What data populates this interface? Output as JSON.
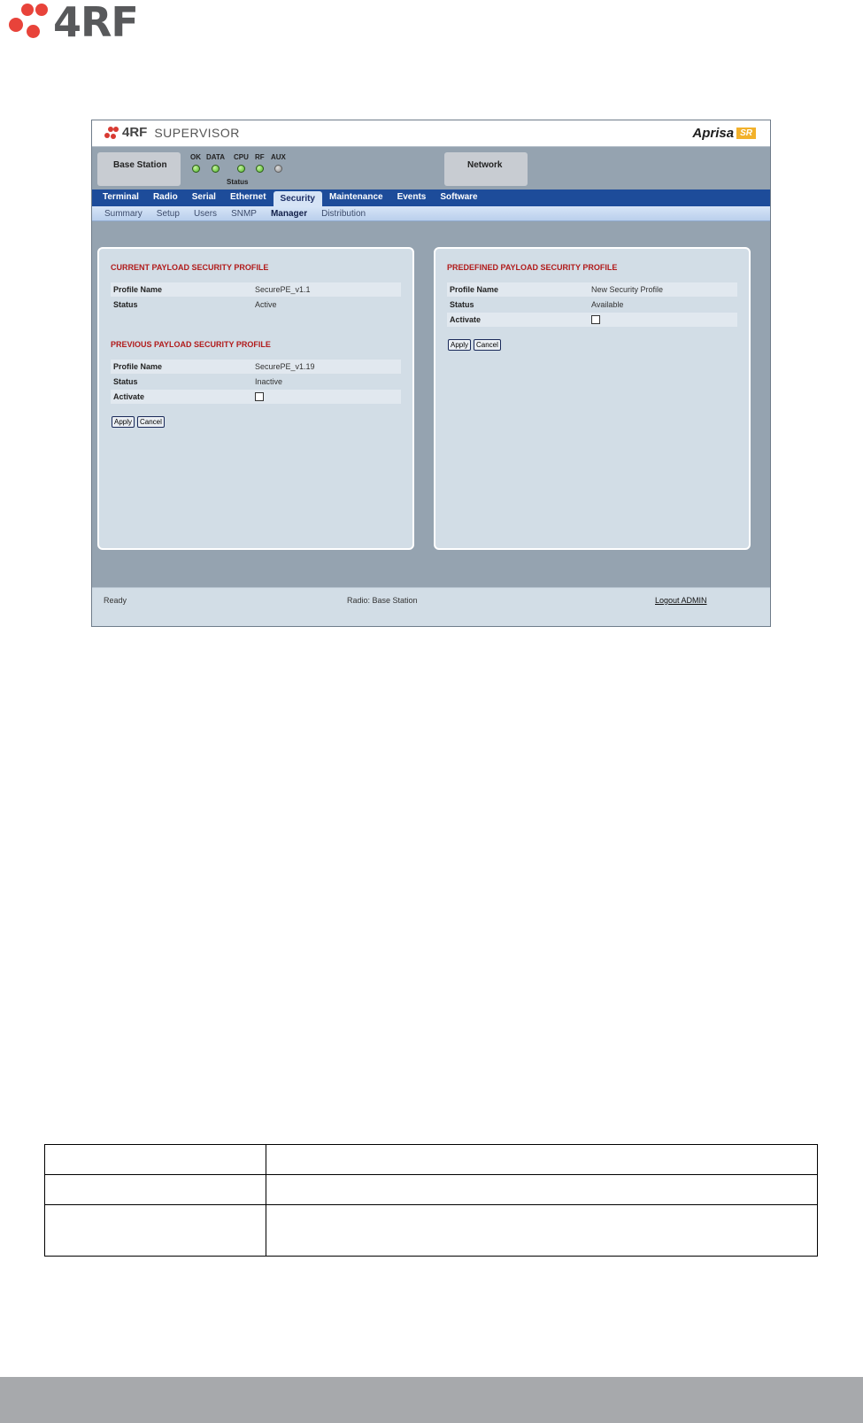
{
  "doc": {
    "brand": "4RF"
  },
  "app": {
    "logo": "4RF",
    "logo_suffix": "SUPERVISOR",
    "product": "Aprisa",
    "product_badge": "SR"
  },
  "status": {
    "station_label": "Base Station",
    "network_label": "Network",
    "caption": "Status",
    "leds": [
      {
        "label": "OK",
        "on": true
      },
      {
        "label": "DATA",
        "on": true
      },
      {
        "label": "CPU",
        "on": true
      },
      {
        "label": "RF",
        "on": true
      },
      {
        "label": "AUX",
        "on": false
      }
    ]
  },
  "nav": {
    "tabs": [
      "Terminal",
      "Radio",
      "Serial",
      "Ethernet",
      "Security",
      "Maintenance",
      "Events",
      "Software"
    ],
    "active": "Security",
    "subtabs": [
      "Summary",
      "Setup",
      "Users",
      "SNMP",
      "Manager",
      "Distribution"
    ],
    "active_sub": "Manager"
  },
  "left_panel": {
    "current_heading": "CURRENT PAYLOAD SECURITY PROFILE",
    "current_rows": [
      {
        "key": "Profile Name",
        "value": "SecurePE_v1.1"
      },
      {
        "key": "Status",
        "value": "Active"
      }
    ],
    "previous_heading": "PREVIOUS PAYLOAD SECURITY PROFILE",
    "previous_rows": [
      {
        "key": "Profile Name",
        "value": "SecurePE_v1.19"
      },
      {
        "key": "Status",
        "value": "Inactive"
      },
      {
        "key": "Activate",
        "value": ""
      }
    ],
    "apply_label": "Apply",
    "cancel_label": "Cancel"
  },
  "right_panel": {
    "heading": "PREDEFINED PAYLOAD SECURITY PROFILE",
    "rows": [
      {
        "key": "Profile Name",
        "value": "New Security Profile"
      },
      {
        "key": "Status",
        "value": "Available"
      },
      {
        "key": "Activate",
        "value": ""
      }
    ],
    "apply_label": "Apply",
    "cancel_label": "Cancel"
  },
  "footer": {
    "status": "Ready",
    "radio": "Radio: Base Station",
    "logout": "Logout ADMIN"
  }
}
